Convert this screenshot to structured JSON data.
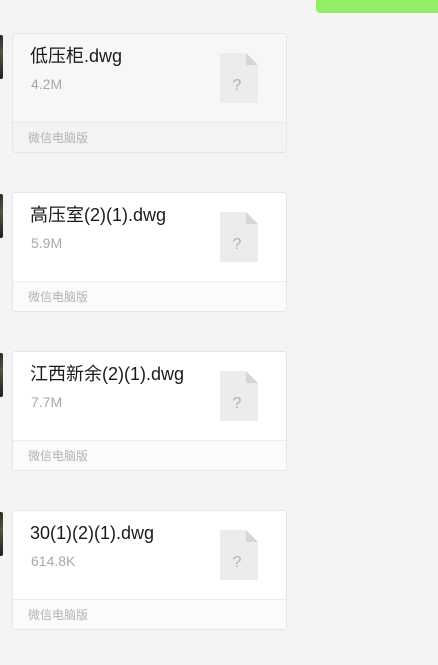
{
  "messages": [
    {
      "file_name": "低压柜.dwg",
      "file_size": "4.2M",
      "source": "微信电脑版",
      "file_icon": "unknown-file-icon",
      "icon_glyph": "?"
    },
    {
      "file_name": "高压室(2)(1).dwg",
      "file_size": "5.9M",
      "source": "微信电脑版",
      "file_icon": "unknown-file-icon",
      "icon_glyph": "?"
    },
    {
      "file_name": "江西新余(2)(1).dwg",
      "file_size": "7.7M",
      "source": "微信电脑版",
      "file_icon": "unknown-file-icon",
      "icon_glyph": "?"
    },
    {
      "file_name": "30(1)(2)(1).dwg",
      "file_size": "614.8K",
      "source": "微信电脑版",
      "file_icon": "unknown-file-icon",
      "icon_glyph": "?"
    }
  ],
  "colors": {
    "background": "#f4f4f4",
    "card": "#ffffff",
    "sent_bubble": "#95ec69",
    "file_name": "#1a1a1a",
    "muted_text": "#a8a8a8"
  }
}
